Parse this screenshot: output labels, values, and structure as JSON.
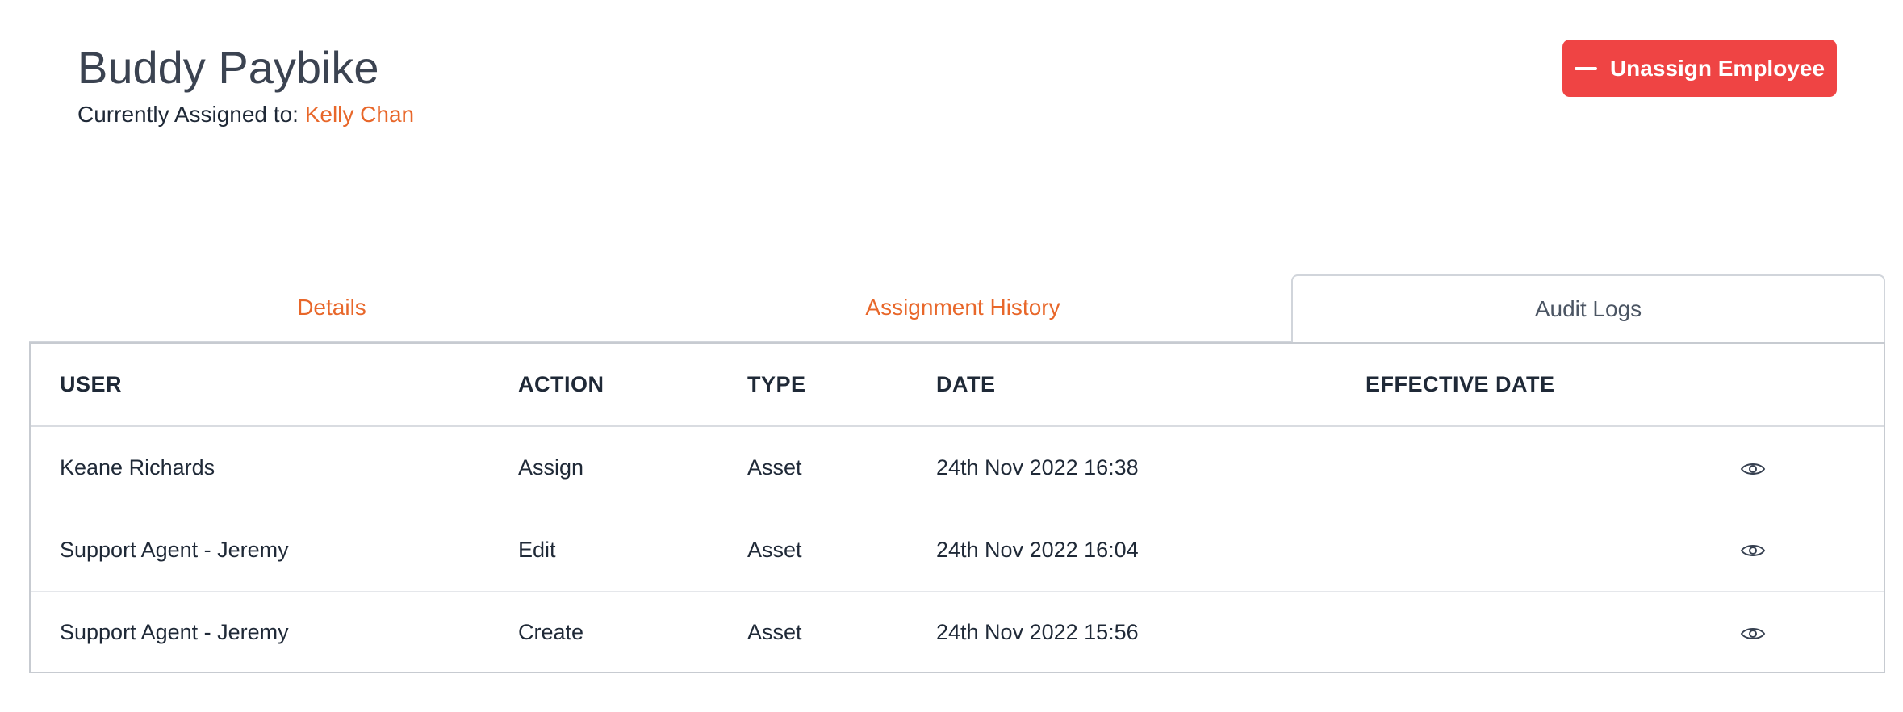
{
  "header": {
    "title": "Buddy Paybike",
    "assigned_label": "Currently Assigned to: ",
    "assigned_name": "Kelly Chan"
  },
  "actions": {
    "unassign_label": "Unassign Employee"
  },
  "tabs": [
    {
      "label": "Details",
      "active": false
    },
    {
      "label": "Assignment History",
      "active": false
    },
    {
      "label": "Audit Logs",
      "active": true
    }
  ],
  "table": {
    "columns": [
      "USER",
      "ACTION",
      "TYPE",
      "DATE",
      "EFFECTIVE DATE"
    ],
    "rows": [
      {
        "user": "Keane Richards",
        "action": "Assign",
        "type": "Asset",
        "date": "24th Nov 2022 16:38",
        "effective_date": ""
      },
      {
        "user": "Support Agent - Jeremy",
        "action": "Edit",
        "type": "Asset",
        "date": "24th Nov 2022 16:04",
        "effective_date": ""
      },
      {
        "user": "Support Agent - Jeremy",
        "action": "Create",
        "type": "Asset",
        "date": "24th Nov 2022 15:56",
        "effective_date": ""
      }
    ]
  },
  "icons": {
    "row_action": "eye-icon",
    "button": "minus-icon"
  },
  "colors": {
    "accent": "#e8672a",
    "danger": "#ef4444",
    "title": "#3b4351"
  }
}
